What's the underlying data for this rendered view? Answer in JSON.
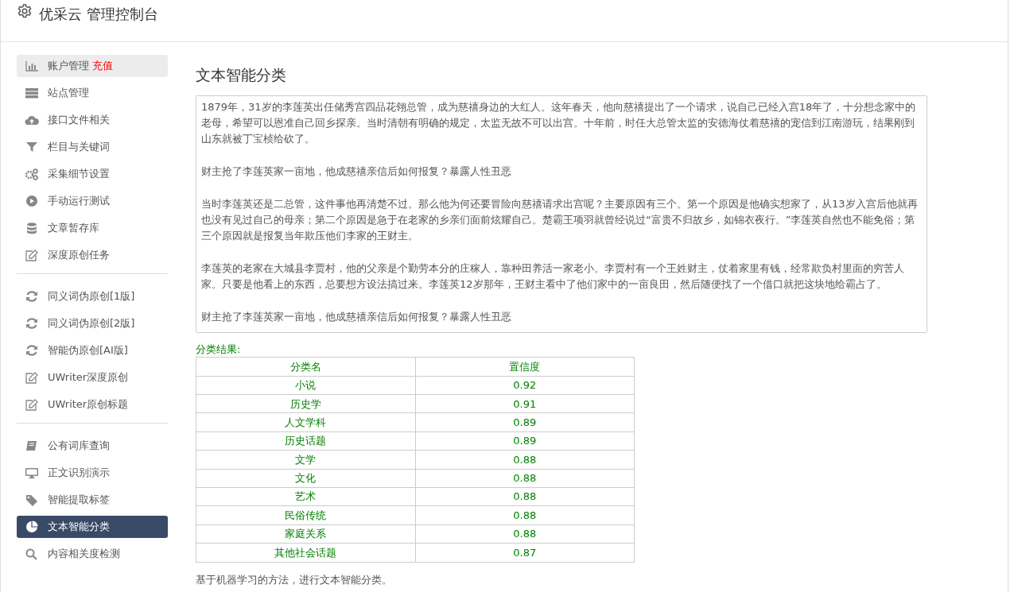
{
  "header": {
    "title": "优采云 管理控制台"
  },
  "sidebar": {
    "groups": [
      {
        "items": [
          {
            "label": "账户管理",
            "extra": "充值",
            "highlighted": true,
            "selected": false
          },
          {
            "label": "站点管理",
            "highlighted": false,
            "selected": false
          },
          {
            "label": "接口文件相关",
            "highlighted": false,
            "selected": false
          },
          {
            "label": "栏目与关键词",
            "highlighted": false,
            "selected": false
          },
          {
            "label": "采集细节设置",
            "highlighted": false,
            "selected": false
          },
          {
            "label": "手动运行测试",
            "highlighted": false,
            "selected": false
          },
          {
            "label": "文章暂存库",
            "highlighted": false,
            "selected": false
          },
          {
            "label": "深度原创任务",
            "highlighted": false,
            "selected": false
          }
        ]
      },
      {
        "items": [
          {
            "label": "同义词伪原创[1版]",
            "highlighted": false,
            "selected": false
          },
          {
            "label": "同义词伪原创[2版]",
            "highlighted": false,
            "selected": false
          },
          {
            "label": "智能伪原创[AI版]",
            "highlighted": false,
            "selected": false
          },
          {
            "label": "UWriter深度原创",
            "highlighted": false,
            "selected": false
          },
          {
            "label": "UWriter原创标题",
            "highlighted": false,
            "selected": false
          }
        ]
      },
      {
        "items": [
          {
            "label": "公有词库查询",
            "highlighted": false,
            "selected": false
          },
          {
            "label": "正文识别演示",
            "highlighted": false,
            "selected": false
          },
          {
            "label": "智能提取标签",
            "highlighted": false,
            "selected": false
          },
          {
            "label": "文本智能分类",
            "highlighted": false,
            "selected": true
          },
          {
            "label": "内容相关度检测",
            "highlighted": false,
            "selected": false
          }
        ]
      }
    ]
  },
  "main": {
    "title": "文本智能分类",
    "text_input": {
      "paragraphs": [
        "1879年，31岁的李莲英出任储秀宫四品花翎总管，成为慈禧身边的大红人。这年春天，他向慈禧提出了一个请求，说自己已经入宫18年了，十分想念家中的老母，希望可以恩准自己回乡探亲。当时清朝有明确的规定，太监无故不可以出宫。十年前，时任大总管太监的安德海仗着慈禧的宠信到江南游玩，结果刚到山东就被丁宝桢给砍了。",
        "财主抢了李莲英家一亩地，他成慈禧亲信后如何报复？暴露人性丑恶",
        "当时李莲英还是二总管，这件事他再清楚不过。那么他为何还要冒险向慈禧请求出宫呢？主要原因有三个。第一个原因是他确实想家了，从13岁入宫后他就再也没有见过自己的母亲；第二个原因是急于在老家的乡亲们面前炫耀自己。楚霸王项羽就曾经说过“富贵不归故乡，如锦衣夜行。”李莲英自然也不能免俗；第三个原因就是报复当年欺压他们李家的王财主。",
        "李莲英的老家在大城县李贾村，他的父亲是个勤劳本分的庄稼人，靠种田养活一家老小。李贾村有一个王姓财主，仗着家里有钱，经常欺负村里面的穷苦人家。只要是他看上的东西，总要想方设法搞过来。李莲英12岁那年，王财主看中了他们家中的一亩良田，然后随便找了一个借口就把这块地给霸占了。",
        "财主抢了李莲英家一亩地，他成慈禧亲信后如何报复？暴露人性丑恶"
      ]
    },
    "result_label": "分类结果:",
    "table": {
      "columns": [
        "分类名",
        "置信度"
      ],
      "rows": [
        [
          "小说",
          "0.92"
        ],
        [
          "历史学",
          "0.91"
        ],
        [
          "人文学科",
          "0.89"
        ],
        [
          "历史话题",
          "0.89"
        ],
        [
          "文学",
          "0.88"
        ],
        [
          "文化",
          "0.88"
        ],
        [
          "艺术",
          "0.88"
        ],
        [
          "民俗传统",
          "0.88"
        ],
        [
          "家庭关系",
          "0.88"
        ],
        [
          "其他社会话题",
          "0.87"
        ]
      ]
    },
    "note": "基于机器学习的方法，进行文本智能分类。"
  }
}
